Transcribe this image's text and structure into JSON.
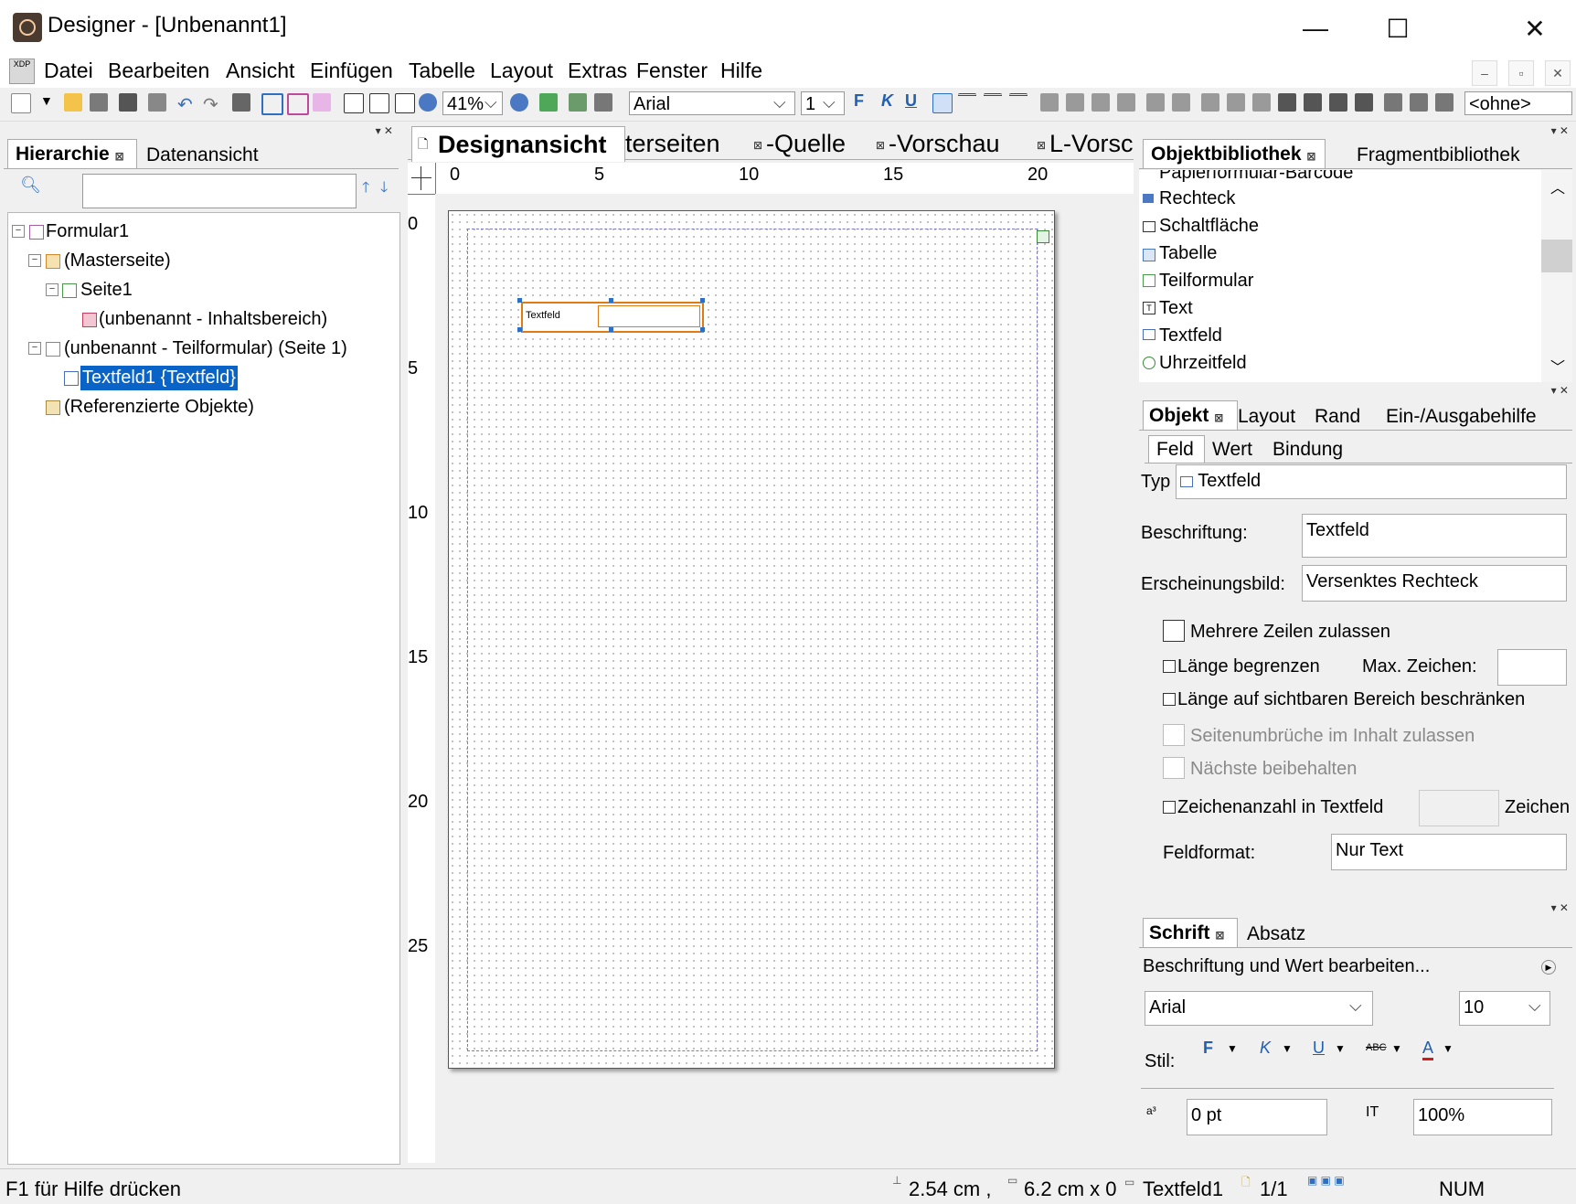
{
  "window": {
    "title": "Designer - [Unbenannt1]",
    "minimize": "—",
    "maximize": "☐",
    "close": "✕"
  },
  "menu": [
    "Datei",
    "Bearbeiten",
    "Ansicht",
    "Einfügen",
    "Tabelle",
    "Layout",
    "Extras",
    "Fenster",
    "Hilfe"
  ],
  "toolbar": {
    "zoom": "41%",
    "font": "Arial",
    "size": "1",
    "bold": "F",
    "italic": "K",
    "underline": "U",
    "style_select": "<ohne>"
  },
  "left_panel": {
    "tabs": [
      "Hierarchie",
      "Datenansicht"
    ],
    "tree": [
      "Formular1",
      "(Masterseite)",
      "Seite1",
      "(unbenannt - Inhaltsbereich)",
      "(unbenannt - Teilformular) (Seite 1)",
      "Textfeld1 {Textfeld}",
      "(Referenzierte Objekte)"
    ]
  },
  "center": {
    "tabs": [
      "Designansicht",
      "terseiten",
      "-Quelle",
      "-Vorschau",
      "L-Vorsch"
    ],
    "ruler_h": [
      "0",
      "5",
      "10",
      "15",
      "20"
    ],
    "ruler_v": [
      "0",
      "5",
      "10",
      "15",
      "20",
      "25"
    ],
    "field_caption": "Textfeld"
  },
  "library": {
    "tabs": [
      "Objektbibliothek",
      "Fragmentbibliothek"
    ],
    "items": [
      "Papierformular-Barcode",
      "Rechteck",
      "Schaltfläche",
      "Tabelle",
      "Teilformular",
      "Text",
      "Textfeld",
      "Uhrzeitfeld"
    ]
  },
  "object_panel": {
    "tabs": [
      "Objekt",
      "Layout",
      "Rand",
      "Ein-/Ausgabehilfe"
    ],
    "subtabs": [
      "Feld",
      "Wert",
      "Bindung"
    ],
    "typ_label": "Typ",
    "typ_value": "Textfeld",
    "caption_label": "Beschriftung:",
    "caption_value": "Textfeld",
    "appearance_label": "Erscheinungsbild:",
    "appearance_value": "Versenktes Rechteck",
    "multi_line": "Mehrere Zeilen zulassen",
    "limit_length": "Länge begrenzen",
    "max_chars_label": "Max. Zeichen:",
    "limit_visible": "Länge auf sichtbaren Bereich beschränken",
    "page_breaks": "Seitenumbrüche im Inhalt zulassen",
    "keep_next": "Nächste beibehalten",
    "comb": "Zeichenanzahl in Textfeld",
    "comb_unit": "Zeichen",
    "format_label": "Feldformat:",
    "format_value": "Nur Text"
  },
  "font_panel": {
    "tabs": [
      "Schrift",
      "Absatz"
    ],
    "edit_label": "Beschriftung und Wert bearbeiten...",
    "font": "Arial",
    "size": "10",
    "style_label": "Stil:",
    "bold": "F",
    "italic": "K",
    "underline": "U",
    "strike": "ABC",
    "color": "A",
    "baseline": "0 pt",
    "scale": "100%"
  },
  "status": {
    "help": "F1 für Hilfe drücken",
    "position": "2.54 cm ,",
    "size": "6.2 cm x 0",
    "object": "Textfeld1",
    "page": "1/1",
    "num": "NUM"
  }
}
